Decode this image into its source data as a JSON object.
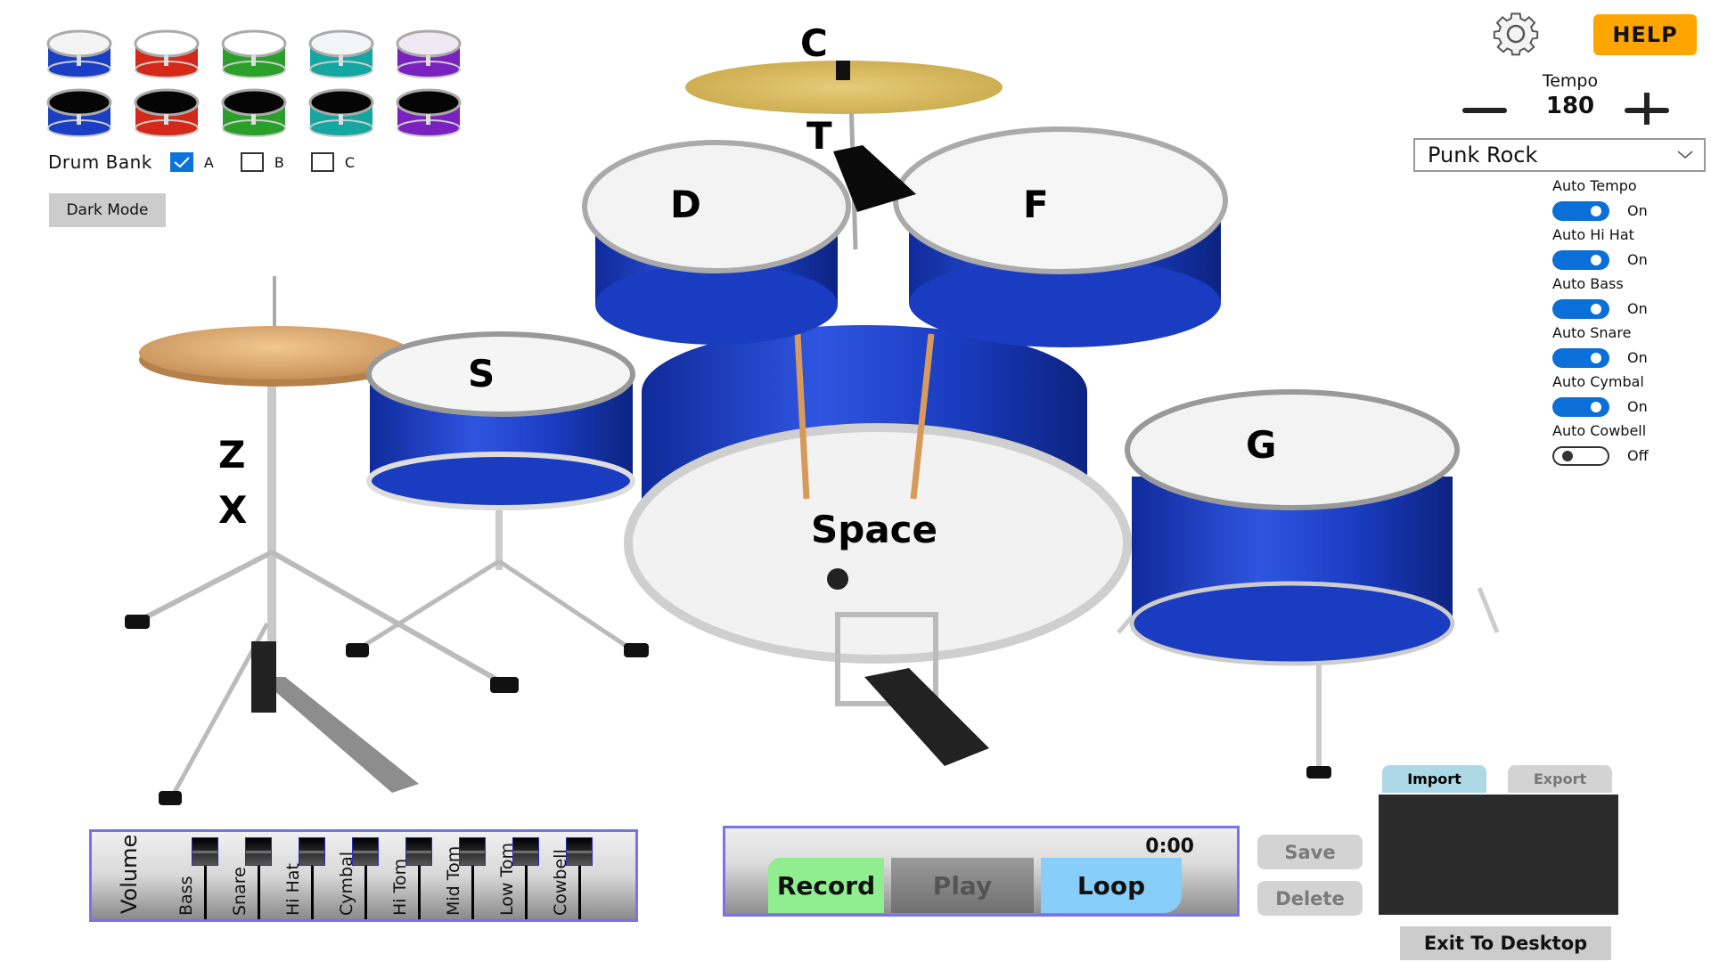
{
  "swatches": [
    {
      "name": "blue-white",
      "shell": "#1a3fc4",
      "head": "#f4f4f4"
    },
    {
      "name": "red-white",
      "shell": "#d42818",
      "head": "#ffffff"
    },
    {
      "name": "green-white",
      "shell": "#2aa02a",
      "head": "#ffffff"
    },
    {
      "name": "teal-white",
      "shell": "#14a6a0",
      "head": "#f2f6f6"
    },
    {
      "name": "purple-white",
      "shell": "#7a22c0",
      "head": "#eeeaf4"
    },
    {
      "name": "blue-black",
      "shell": "#1a3fc4",
      "head": "#050505"
    },
    {
      "name": "red-black",
      "shell": "#d42818",
      "head": "#050505"
    },
    {
      "name": "green-black",
      "shell": "#2aa02a",
      "head": "#050505"
    },
    {
      "name": "teal-black",
      "shell": "#14a6a0",
      "head": "#050505"
    },
    {
      "name": "purple-black",
      "shell": "#7a22c0",
      "head": "#050505"
    }
  ],
  "drum_bank": {
    "label": "Drum Bank",
    "options": [
      {
        "label": "A",
        "checked": true
      },
      {
        "label": "B",
        "checked": false
      },
      {
        "label": "C",
        "checked": false
      }
    ]
  },
  "dark_mode_label": "Dark Mode",
  "help_label": "HELP",
  "tempo": {
    "label": "Tempo",
    "value": "180",
    "minus": "—",
    "plus": "+"
  },
  "style_select": {
    "value": "Punk Rock"
  },
  "auto_toggles": [
    {
      "label": "Auto Tempo",
      "state": "On",
      "on": true
    },
    {
      "label": "Auto Hi Hat",
      "state": "On",
      "on": true
    },
    {
      "label": "Auto Bass",
      "state": "On",
      "on": true
    },
    {
      "label": "Auto Snare",
      "state": "On",
      "on": true
    },
    {
      "label": "Auto Cymbal",
      "state": "On",
      "on": true
    },
    {
      "label": "Auto Cowbell",
      "state": "Off",
      "on": false
    }
  ],
  "kit_keys": {
    "cymbal": "C",
    "cowbell": "T",
    "hi_tom": "D",
    "mid_tom": "F",
    "snare": "S",
    "hihat_open": "Z",
    "hihat_closed": "X",
    "bass": "Space",
    "low_tom": "G"
  },
  "volume": {
    "title": "Volume",
    "channels": [
      "Bass",
      "Snare",
      "Hi Hat",
      "Cymbal",
      "Hi Tom",
      "Mid Tom",
      "Low Tom",
      "Cowbell"
    ],
    "levels": [
      1,
      1,
      1,
      1,
      1,
      1,
      1,
      1
    ]
  },
  "recorder": {
    "time": "0:00",
    "record": "Record",
    "play": "Play",
    "loop": "Loop"
  },
  "save_label": "Save",
  "delete_label": "Delete",
  "tabs": {
    "import": "Import",
    "export": "Export"
  },
  "exit_label": "Exit To Desktop",
  "colors": {
    "accent": "#0a6fd6",
    "help": "#ffa500",
    "record": "#90ee90",
    "loop": "#87cefa",
    "import_tab": "#add8e6",
    "kit_shell": "#1f3fc8"
  }
}
